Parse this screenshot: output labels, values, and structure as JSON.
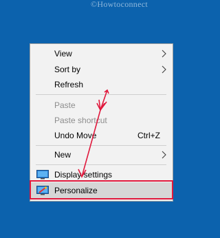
{
  "watermark": "©Howtoconnect",
  "menu": {
    "items": [
      {
        "label": "View",
        "submenu": true,
        "disabled": false
      },
      {
        "label": "Sort by",
        "submenu": true,
        "disabled": false
      },
      {
        "label": "Refresh",
        "submenu": false,
        "disabled": false
      },
      {
        "label": "Paste",
        "submenu": false,
        "disabled": true
      },
      {
        "label": "Paste shortcut",
        "submenu": false,
        "disabled": true
      },
      {
        "label": "Undo Move",
        "shortcut": "Ctrl+Z",
        "submenu": false,
        "disabled": false
      },
      {
        "label": "New",
        "submenu": true,
        "disabled": false
      },
      {
        "label": "Display settings",
        "icon": "display-settings-icon",
        "submenu": false,
        "disabled": false
      },
      {
        "label": "Personalize",
        "icon": "personalize-icon",
        "submenu": false,
        "disabled": false,
        "highlighted": true
      }
    ]
  },
  "colors": {
    "desktop": "#0c62ad",
    "menu_bg": "#f2f2f2",
    "highlight_bg": "#d6d6d6",
    "annotation_red": "#e0183c"
  }
}
